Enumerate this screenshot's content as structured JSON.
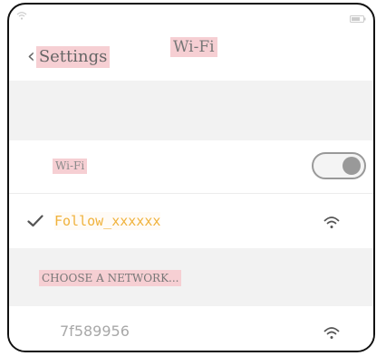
{
  "navbar": {
    "back_label": "Settings",
    "title": "Wi-Fi"
  },
  "wifi_toggle": {
    "label": "Wi-Fi",
    "state": "on"
  },
  "connected_network": {
    "name": "Follow_xxxxxx",
    "icon": "checkmark-icon",
    "color": "#f0b23c"
  },
  "network_list": {
    "header": "CHOOSE A NETWORK...",
    "items": [
      {
        "name": "7f589956",
        "icon": "wifi-signal-icon"
      }
    ]
  },
  "colors": {
    "label_highlight": "#f6cfd3",
    "section_background": "#f2f2f2",
    "accent": "#f0b23c"
  }
}
